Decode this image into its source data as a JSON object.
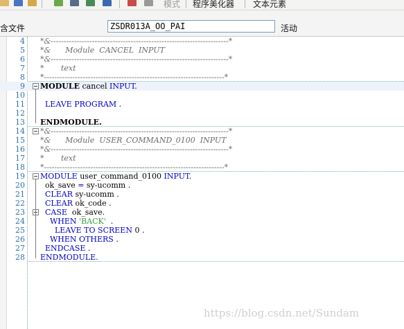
{
  "toolbar": {
    "menu_items": [
      {
        "label": "模式",
        "disabled": true
      },
      {
        "label": "程序美化器",
        "disabled": false
      },
      {
        "label": "文本元素",
        "disabled": false
      }
    ]
  },
  "header": {
    "include_label": "含文件",
    "program_name": "ZSDR013A_OO_PAI",
    "status": "活动"
  },
  "colors": {
    "keyword": "#0000c8",
    "string": "#3a9a3a",
    "comment": "#6a6a6a",
    "line_number": "#2f6fa8"
  },
  "editor": {
    "lines": [
      {
        "num": "4",
        "type": "comment",
        "fold": false,
        "indent": "",
        "tokens": [
          {
            "t": "*&---------------------------------------------------------------------*",
            "k": "c"
          }
        ]
      },
      {
        "num": "5",
        "type": "comment",
        "fold": false,
        "indent": "",
        "tokens": [
          {
            "t": "*&      Module  CANCEL  INPUT",
            "k": "c"
          }
        ]
      },
      {
        "num": "6",
        "type": "comment",
        "fold": false,
        "indent": "",
        "tokens": [
          {
            "t": "*&---------------------------------------------------------------------*",
            "k": "c"
          }
        ]
      },
      {
        "num": "7",
        "type": "comment",
        "fold": false,
        "indent": "",
        "tokens": [
          {
            "t": "*       text",
            "k": "c"
          }
        ]
      },
      {
        "num": "8",
        "type": "comment",
        "fold": false,
        "indent": "",
        "divider": true,
        "tokens": [
          {
            "t": "*----------------------------------------------------------------------*",
            "k": "c"
          }
        ]
      },
      {
        "num": "9",
        "type": "code",
        "fold": true,
        "current": true,
        "tokens": [
          {
            "t": "MODULE",
            "k": "b"
          },
          {
            "t": " cancel ",
            "k": "n"
          },
          {
            "t": "INPUT",
            "k": "k"
          },
          {
            "t": ".",
            "k": "n"
          }
        ]
      },
      {
        "num": "10",
        "type": "code",
        "fold": false,
        "tokens": []
      },
      {
        "num": "11",
        "type": "code",
        "fold": false,
        "tokens": [
          {
            "t": "  ",
            "k": "n"
          },
          {
            "t": "LEAVE PROGRAM",
            "k": "k"
          },
          {
            "t": " .",
            "k": "n"
          }
        ]
      },
      {
        "num": "12",
        "type": "code",
        "fold": false,
        "tokens": []
      },
      {
        "num": "13",
        "type": "code",
        "fold": false,
        "divider": true,
        "tokens": [
          {
            "t": "ENDMODULE.",
            "k": "b"
          }
        ]
      },
      {
        "num": "14",
        "type": "comment",
        "fold": true,
        "tokens": [
          {
            "t": "*&---------------------------------------------------------------------*",
            "k": "c"
          }
        ]
      },
      {
        "num": "15",
        "type": "comment",
        "fold": false,
        "tokens": [
          {
            "t": "*&      Module  USER_COMMAND_0100  INPUT",
            "k": "c"
          }
        ]
      },
      {
        "num": "16",
        "type": "comment",
        "fold": false,
        "tokens": [
          {
            "t": "*&---------------------------------------------------------------------*",
            "k": "c"
          }
        ]
      },
      {
        "num": "17",
        "type": "comment",
        "fold": false,
        "tokens": [
          {
            "t": "*       text",
            "k": "c"
          }
        ]
      },
      {
        "num": "18",
        "type": "comment",
        "fold": false,
        "divider": true,
        "tokens": [
          {
            "t": "*----------------------------------------------------------------------*",
            "k": "c"
          }
        ]
      },
      {
        "num": "19",
        "type": "code",
        "fold": true,
        "tokens": [
          {
            "t": "MODULE",
            "k": "k"
          },
          {
            "t": " user_command_0100 ",
            "k": "n"
          },
          {
            "t": "INPUT",
            "k": "k"
          },
          {
            "t": ".",
            "k": "n"
          }
        ]
      },
      {
        "num": "20",
        "type": "code",
        "fold": false,
        "tokens": [
          {
            "t": "  ok_save ",
            "k": "n"
          },
          {
            "t": "=",
            "k": "k"
          },
          {
            "t": " sy-ucomm ",
            "k": "n"
          },
          {
            "t": ".",
            "k": "n"
          }
        ]
      },
      {
        "num": "21",
        "type": "code",
        "fold": false,
        "tokens": [
          {
            "t": "  ",
            "k": "n"
          },
          {
            "t": "CLEAR",
            "k": "k"
          },
          {
            "t": " sy-ucomm ",
            "k": "n"
          },
          {
            "t": ".",
            "k": "n"
          }
        ]
      },
      {
        "num": "22",
        "type": "code",
        "fold": false,
        "tokens": [
          {
            "t": "  ",
            "k": "n"
          },
          {
            "t": "CLEAR",
            "k": "k"
          },
          {
            "t": " ok_code ",
            "k": "n"
          },
          {
            "t": ".",
            "k": "n"
          }
        ]
      },
      {
        "num": "23",
        "type": "code",
        "fold": true,
        "tokens": [
          {
            "t": "  ",
            "k": "n"
          },
          {
            "t": "CASE",
            "k": "k"
          },
          {
            "t": "  ok_save.",
            "k": "n"
          }
        ]
      },
      {
        "num": "24",
        "type": "code",
        "fold": false,
        "tokens": [
          {
            "t": "    ",
            "k": "n"
          },
          {
            "t": "WHEN",
            "k": "k"
          },
          {
            "t": " ",
            "k": "n"
          },
          {
            "t": "'BACK'",
            "k": "s"
          },
          {
            "t": "  .",
            "k": "n"
          }
        ]
      },
      {
        "num": "25",
        "type": "code",
        "fold": false,
        "tokens": [
          {
            "t": "      ",
            "k": "n"
          },
          {
            "t": "LEAVE TO SCREEN",
            "k": "k"
          },
          {
            "t": " 0 .",
            "k": "n"
          }
        ]
      },
      {
        "num": "26",
        "type": "code",
        "fold": false,
        "tokens": [
          {
            "t": "    ",
            "k": "n"
          },
          {
            "t": "WHEN OTHERS",
            "k": "k"
          },
          {
            "t": " .",
            "k": "n"
          }
        ]
      },
      {
        "num": "27",
        "type": "code",
        "fold": false,
        "tokens": [
          {
            "t": "  ",
            "k": "n"
          },
          {
            "t": "ENDCASE",
            "k": "k"
          },
          {
            "t": " .",
            "k": "n"
          }
        ]
      },
      {
        "num": "28",
        "type": "code",
        "fold": false,
        "divider": true,
        "tokens": [
          {
            "t": "ENDMODULE.",
            "k": "k"
          }
        ]
      }
    ]
  },
  "watermark": "https://blog.csdn.net/Sundam"
}
